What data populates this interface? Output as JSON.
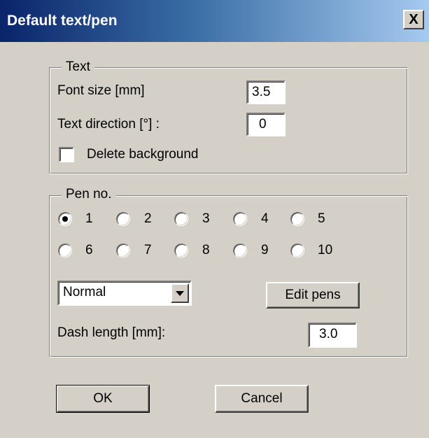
{
  "dialog": {
    "title": "Default text/pen",
    "close_glyph": "X"
  },
  "text_group": {
    "legend": "Text",
    "font_size_label": "Font size [mm]",
    "font_size_value": "3.5",
    "text_direction_label": "Text direction [°] :",
    "text_direction_value": "0",
    "delete_background_label": "Delete background",
    "delete_background_checked": false
  },
  "pen_group": {
    "legend": "Pen no.",
    "pens": [
      "1",
      "2",
      "3",
      "4",
      "5",
      "6",
      "7",
      "8",
      "9",
      "10"
    ],
    "selected_pen": "1",
    "line_style_value": "Normal",
    "edit_pens_label": "Edit pens",
    "dash_length_label": "Dash length [mm]:",
    "dash_length_value": "3.0"
  },
  "buttons": {
    "ok_label": "OK",
    "cancel_label": "Cancel"
  }
}
